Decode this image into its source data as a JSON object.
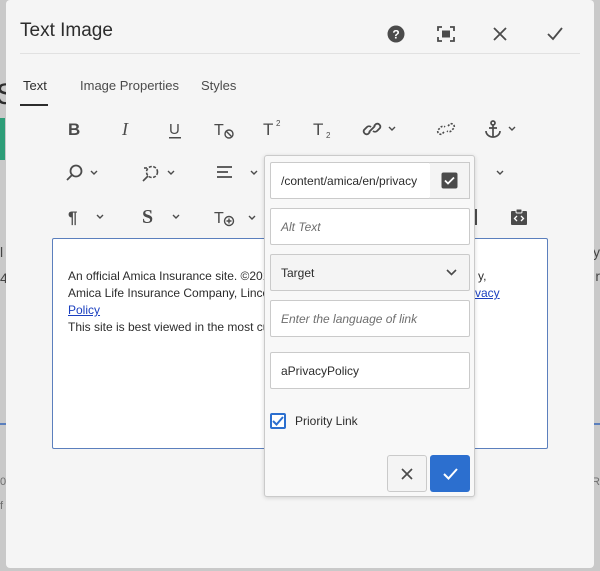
{
  "dialog": {
    "title": "Text Image"
  },
  "header_icons": [
    "help-icon",
    "fullscreen-icon",
    "close-icon",
    "done-icon"
  ],
  "tabs": [
    {
      "label": "Text",
      "active": true
    },
    {
      "label": "Image Properties",
      "active": false
    },
    {
      "label": "Styles",
      "active": false
    }
  ],
  "toolbar": {
    "row1": [
      "bold-icon",
      "italic-icon",
      "underline-icon",
      "clear-format-icon",
      "superscript-icon",
      "subscript-icon",
      "link-icon",
      "unlink-icon",
      "anchor-icon"
    ],
    "row2": [
      "find-icon",
      "find-replace-icon",
      "align-icon"
    ],
    "row3": [
      "paragraph-icon",
      "styles-icon",
      "insert-text-icon",
      "source-edit-icon"
    ]
  },
  "editor": {
    "line1": "An official Amica Insurance site. ©201",
    "line1_right": "y,",
    "line2": "Amica Life Insurance Company, Linco",
    "line2_link": "vacy",
    "line3_link": "Policy",
    "line4": "This site is best viewed in the most cu"
  },
  "link_popover": {
    "path_value": "/content/amica/en/privacy",
    "alt_text_placeholder": "Alt Text",
    "target_label": "Target",
    "language_placeholder": "Enter the language of link",
    "id_value": "aPrivacyPolicy",
    "priority_link_label": "Priority Link",
    "priority_link_checked": true
  },
  "background_fragments": {
    "left_big": "S",
    "left_1": "l",
    "left_4": "4",
    "left_0": "0",
    "left_f": "f",
    "right_y": "y",
    "right_r": "r",
    "right_R": "R"
  },
  "colors": {
    "accent": "#2c6fcf",
    "link": "#1a3fbf",
    "editor_border": "#5b7fbd"
  }
}
